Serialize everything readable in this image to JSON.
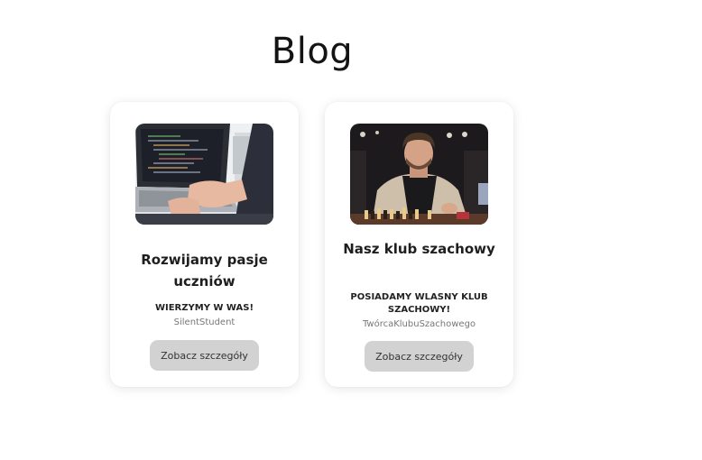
{
  "header": {
    "title": "Blog"
  },
  "posts": [
    {
      "title": "Rozwijamy pasje uczniów",
      "subtitle": "WIERZYMY W WAS!",
      "author": "SilentStudent",
      "button_label": "Zobacz szczegóły",
      "image_icon": "laptop-photo"
    },
    {
      "title": "Nasz klub szachowy",
      "subtitle": "POSIADAMY WLASNY KLUB SZACHOWY!",
      "author": "TwórcaKlubuSzachowego",
      "button_label": "Zobacz szczegóły",
      "image_icon": "chess-player-photo"
    }
  ],
  "colors": {
    "button_bg": "#d2d2d2",
    "title_text": "#141414",
    "author_text": "#777777"
  }
}
